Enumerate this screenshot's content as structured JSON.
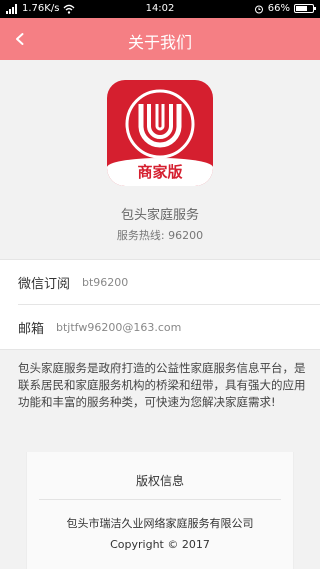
{
  "status_bar": {
    "net_speed": "1.76K/s",
    "time": "14:02",
    "battery": "66%",
    "battery_level": 0.66
  },
  "header": {
    "title": "关于我们"
  },
  "logo": {
    "badge_text": "商家版",
    "colors": {
      "background": "#d51f2f",
      "band": "#ffffff"
    }
  },
  "app": {
    "name": "包头家庭服务",
    "hotline_label": "服务热线:",
    "hotline_number": "96200"
  },
  "contact": [
    {
      "label": "微信订阅",
      "value": "bt96200"
    },
    {
      "label": "邮箱",
      "value": "btjtfw96200@163.com"
    }
  ],
  "description": "包头家庭服务是政府打造的公益性家庭服务信息平台，是联系居民和家庭服务机构的桥梁和纽带，具有强大的应用功能和丰富的服务种类，可快速为您解决家庭需求!",
  "copyright": {
    "title": "版权信息",
    "company": "包头市瑞洁久业网络家庭服务有限公司",
    "year_line": "Copyright © 2017"
  },
  "theme": {
    "accent": "#f57f84",
    "background": "#f2f2f2"
  }
}
